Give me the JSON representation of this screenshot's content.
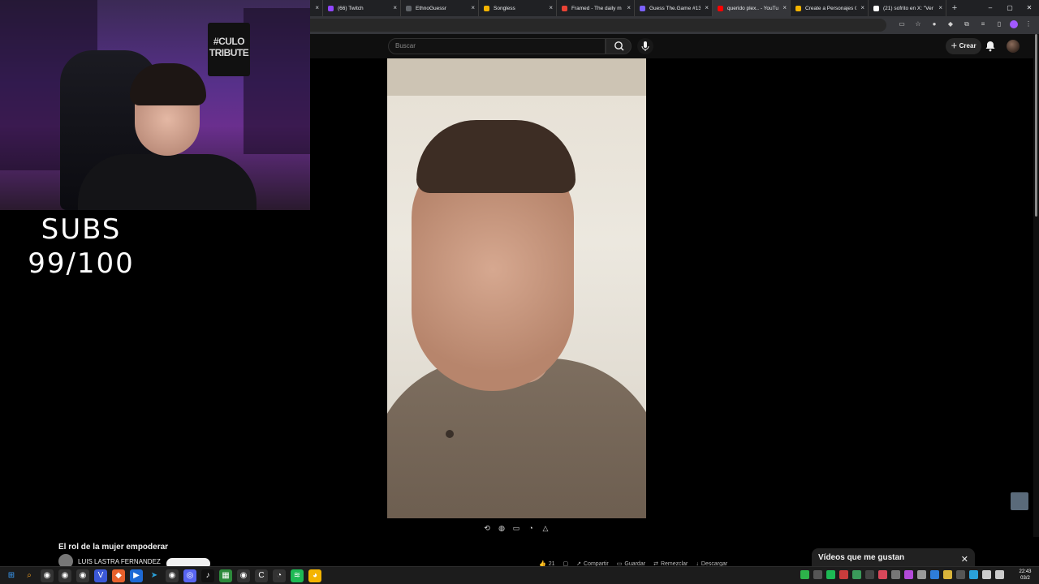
{
  "browser": {
    "tabs": [
      {
        "label": "",
        "color": "#9146ff"
      },
      {
        "label": "(66) Twitch",
        "color": "#9146ff"
      },
      {
        "label": "EthnoGuessr",
        "color": "#5f6368"
      },
      {
        "label": "Songless",
        "color": "#f4b400"
      },
      {
        "label": "Framed - The daily m",
        "color": "#ea4335"
      },
      {
        "label": "Guess The.Game #138",
        "color": "#7b61ff"
      },
      {
        "label": "querido plex.. - YouTu",
        "color": "#ff0000"
      },
      {
        "label": "Create a Personajes Cl",
        "color": "#f4b400"
      },
      {
        "label": "(21) sofrito en X: \"Ver",
        "color": "#ffffff"
      }
    ],
    "new_tab": "+",
    "window_controls": {
      "minimize": "–",
      "restore": "▢",
      "close": "✕"
    }
  },
  "youtube": {
    "search_placeholder": "Buscar",
    "create_label": "Crear",
    "icons": [
      "search-icon",
      "mic-icon",
      "bell-icon",
      "avatar"
    ]
  },
  "overlay": {
    "subs_line1": "SUBS",
    "subs_line2": "99/100",
    "poster_text": "#CULO TRIBUTE"
  },
  "video": {
    "title": "El rol de la mujer empoderar",
    "channel": "LUIS LASTRA FERNANDEZ",
    "actions": [
      {
        "icon": "like-icon",
        "label": "21"
      },
      {
        "icon": "comment-icon",
        "label": ""
      },
      {
        "icon": "share-icon",
        "label": "Compartir"
      },
      {
        "icon": "save-icon",
        "label": "Guardar"
      },
      {
        "icon": "remix-icon",
        "label": "Remezclar"
      },
      {
        "icon": "download-icon",
        "label": "Descargar"
      }
    ]
  },
  "liked_panel": {
    "title": "Vídeos que me gustan",
    "close": "✕"
  },
  "taskbar": {
    "time": "22:43",
    "date": "03/2"
  }
}
